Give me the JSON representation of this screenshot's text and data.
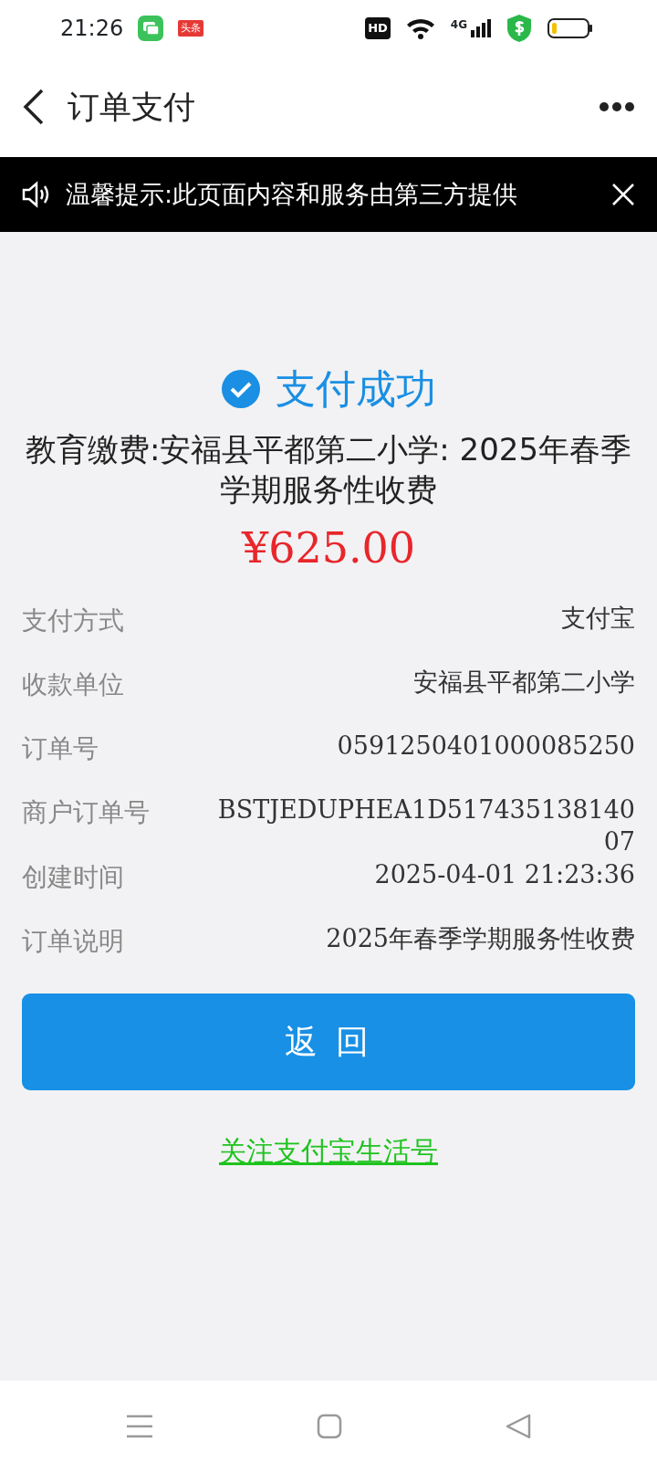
{
  "status_bar": {
    "time": "21:26",
    "news_badge": "头条",
    "hd_badge": "HD",
    "network": "4G"
  },
  "header": {
    "title": "订单支付"
  },
  "notice": {
    "text": "温馨提示:此页面内容和服务由第三方提供"
  },
  "result": {
    "status": "支付成功",
    "title": "教育缴费:安福县平都第二小学: 2025年春季学期服务性收费",
    "amount": "¥625.00"
  },
  "details": [
    {
      "label": "支付方式",
      "value": "支付宝"
    },
    {
      "label": "收款单位",
      "value": "安福县平都第二小学"
    },
    {
      "label": "订单号",
      "value": "0591250401000085250"
    },
    {
      "label": "商户订单号",
      "value": "BSTJEDUPHEA1D51743513814007"
    },
    {
      "label": "创建时间",
      "value": "2025-04-01 21:23:36"
    },
    {
      "label": "订单说明",
      "value": "2025年春季学期服务性收费"
    }
  ],
  "back_button": "返 回",
  "follow_link": "关注支付宝生活号"
}
